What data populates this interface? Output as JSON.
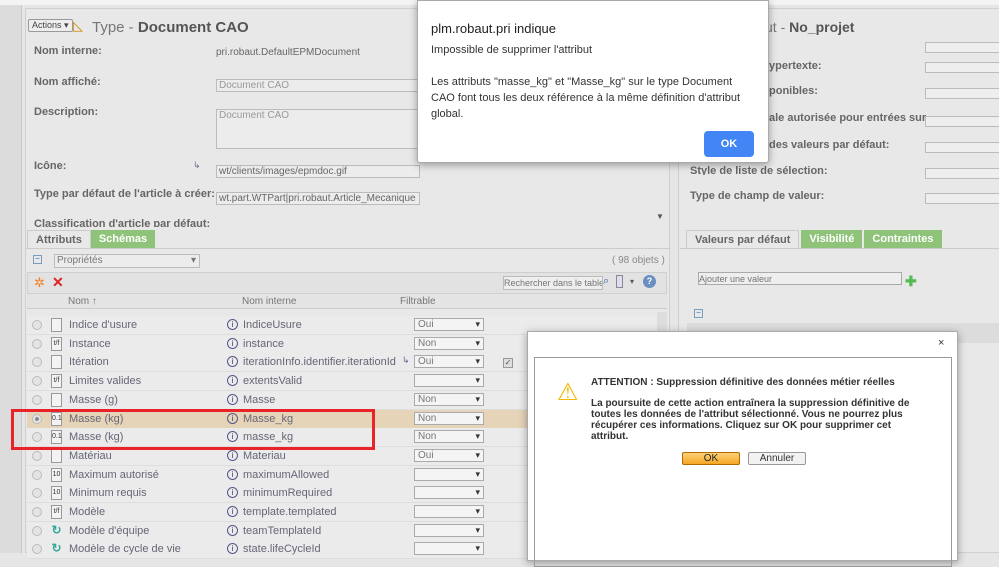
{
  "left_panel": {
    "actions_label": "Actions ▾",
    "title_prefix": "Type - ",
    "title_name": "Document CAO",
    "fields": [
      {
        "label": "Nom interne:",
        "value": "pri.robaut.DefaultEPMDocument"
      },
      {
        "label": "Nom affiché:",
        "value": "Document CAO"
      },
      {
        "label": "Description:",
        "value": "Document CAO"
      },
      {
        "label": "Icône:",
        "value": "wt/clients/images/epmdoc.gif"
      },
      {
        "label": "Type par défaut de l'article à créer:",
        "value": "wt.part.WTPart|pri.robaut.Article_Mecanique"
      },
      {
        "label": "Classification d'article par défaut:",
        "value": ""
      }
    ],
    "tabs": [
      {
        "label": "Attributs"
      },
      {
        "label": "Schémas"
      }
    ],
    "view_select": "Propriétés",
    "object_count": "( 98 objets )",
    "search_placeholder": "Rechercher dans le table",
    "columns": {
      "nom": "Nom ↑",
      "nom_interne": "Nom interne",
      "filtrable": "Filtrable"
    },
    "rows": [
      {
        "name": "Indice d'usure",
        "internal": "IndiceUsure",
        "filtrable": "Oui",
        "icon": "doc"
      },
      {
        "name": "Instance",
        "internal": "instance",
        "filtrable": "Non",
        "icon": "tf"
      },
      {
        "name": "Itération",
        "internal": "iterationInfo.identifier.iterationId",
        "filtrable": "Oui",
        "icon": "doc"
      },
      {
        "name": "Limites valides",
        "internal": "extentsValid",
        "filtrable": "",
        "icon": "tf"
      },
      {
        "name": "Masse (g)",
        "internal": "Masse",
        "filtrable": "Non",
        "icon": "doc"
      },
      {
        "name": "Masse (kg)",
        "internal": "Masse_kg",
        "filtrable": "Non",
        "icon": "real",
        "selected": true
      },
      {
        "name": "Masse (kg)",
        "internal": "masse_kg",
        "filtrable": "Non",
        "icon": "real"
      },
      {
        "name": "Matériau",
        "internal": "Materiau",
        "filtrable": "Oui",
        "icon": "doc"
      },
      {
        "name": "Maximum autorisé",
        "internal": "maximumAllowed",
        "filtrable": "",
        "icon": "int"
      },
      {
        "name": "Minimum requis",
        "internal": "minimumRequired",
        "filtrable": "",
        "icon": "int"
      },
      {
        "name": "Modèle",
        "internal": "template.templated",
        "filtrable": "",
        "icon": "tf"
      },
      {
        "name": "Modèle d'équipe",
        "internal": "teamTemplateId",
        "filtrable": "",
        "icon": "ref"
      },
      {
        "name": "Modèle de cycle de vie",
        "internal": "state.lifeCycleId",
        "filtrable": "",
        "icon": "ref"
      }
    ]
  },
  "right_panel": {
    "title_fragment": "ut - ",
    "title_name": "No_projet",
    "label_fragments": [
      "ypertexte:",
      "ponibles:",
      "ale autorisée pour entrées sur",
      " des valeurs par défaut:",
      "Style de liste de sélection:",
      "Type de champ de valeur:"
    ],
    "tabs": [
      {
        "label": "Valeurs par défaut"
      },
      {
        "label": "Visibilité"
      },
      {
        "label": "Contraintes"
      }
    ],
    "add_value_placeholder": "Ajouter une valeur"
  },
  "browser_alert": {
    "title": "plm.robaut.pri indique",
    "line1": "Impossible de supprimer l'attribut",
    "message": "Les attributs \"masse_kg\" et \"Masse_kg\" sur le type Document CAO font tous les deux référence à la même définition d'attribut global.",
    "ok_label": "OK",
    "ok_color": "#4285f4"
  },
  "confirm_dialog": {
    "close": "×",
    "heading": "ATTENTION : Suppression définitive des données métier réelles",
    "body": "La poursuite de cette action entraînera la suppression définitive de toutes les données de l'attribut sélectionné. Vous ne pourrez plus récupérer ces informations. Cliquez sur OK pour supprimer cet attribut.",
    "ok_label": "OK",
    "cancel_label": "Annuler"
  },
  "highlight_color": "#e8232a"
}
